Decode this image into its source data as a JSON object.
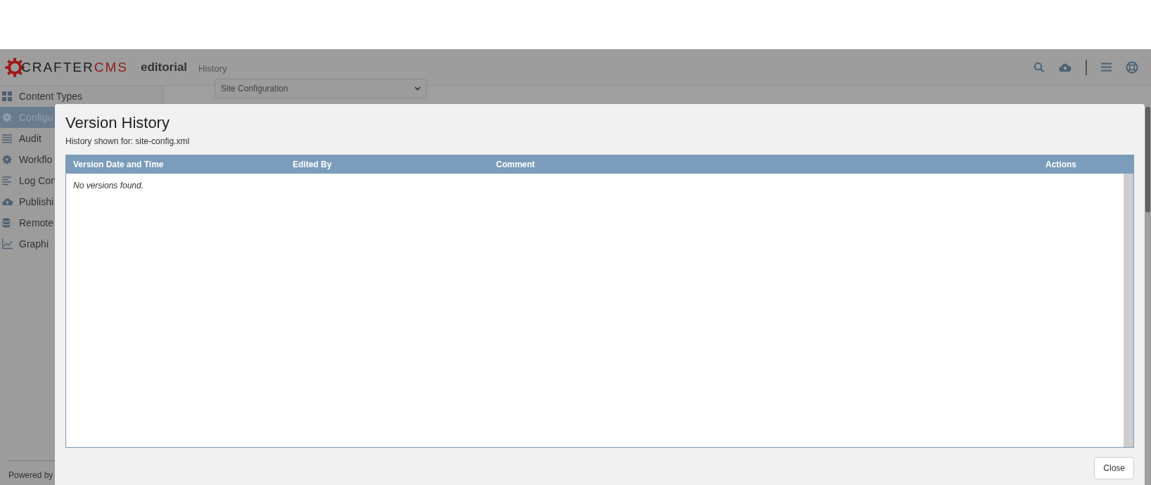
{
  "header": {
    "logo": {
      "brand": "CRAFTER",
      "suffix": "CMS"
    },
    "site": "editorial",
    "page": "History"
  },
  "sidebar": {
    "items": [
      {
        "label": "Content Types",
        "kind": "grid",
        "selected": false
      },
      {
        "label": "Configu",
        "kind": "gear",
        "selected": true
      },
      {
        "label": "Audit",
        "kind": "list",
        "selected": false
      },
      {
        "label": "Workflo",
        "kind": "gear",
        "selected": false
      },
      {
        "label": "Log Con",
        "kind": "align",
        "selected": false
      },
      {
        "label": "Publishi",
        "kind": "cloud",
        "selected": false
      },
      {
        "label": "Remote",
        "kind": "database",
        "selected": false
      },
      {
        "label": "Graphi",
        "kind": "chart",
        "selected": false
      }
    ],
    "footer": "Powered by"
  },
  "content": {
    "select": {
      "value": "Site Configuration"
    }
  },
  "dialog": {
    "title": "Version History",
    "subtitle": "History shown for: site-config.xml",
    "table": {
      "columns": [
        "Version Date and Time",
        "Edited By",
        "Comment",
        "Actions"
      ],
      "empty_message": "No versions found."
    },
    "buttons": [
      "Close"
    ]
  }
}
